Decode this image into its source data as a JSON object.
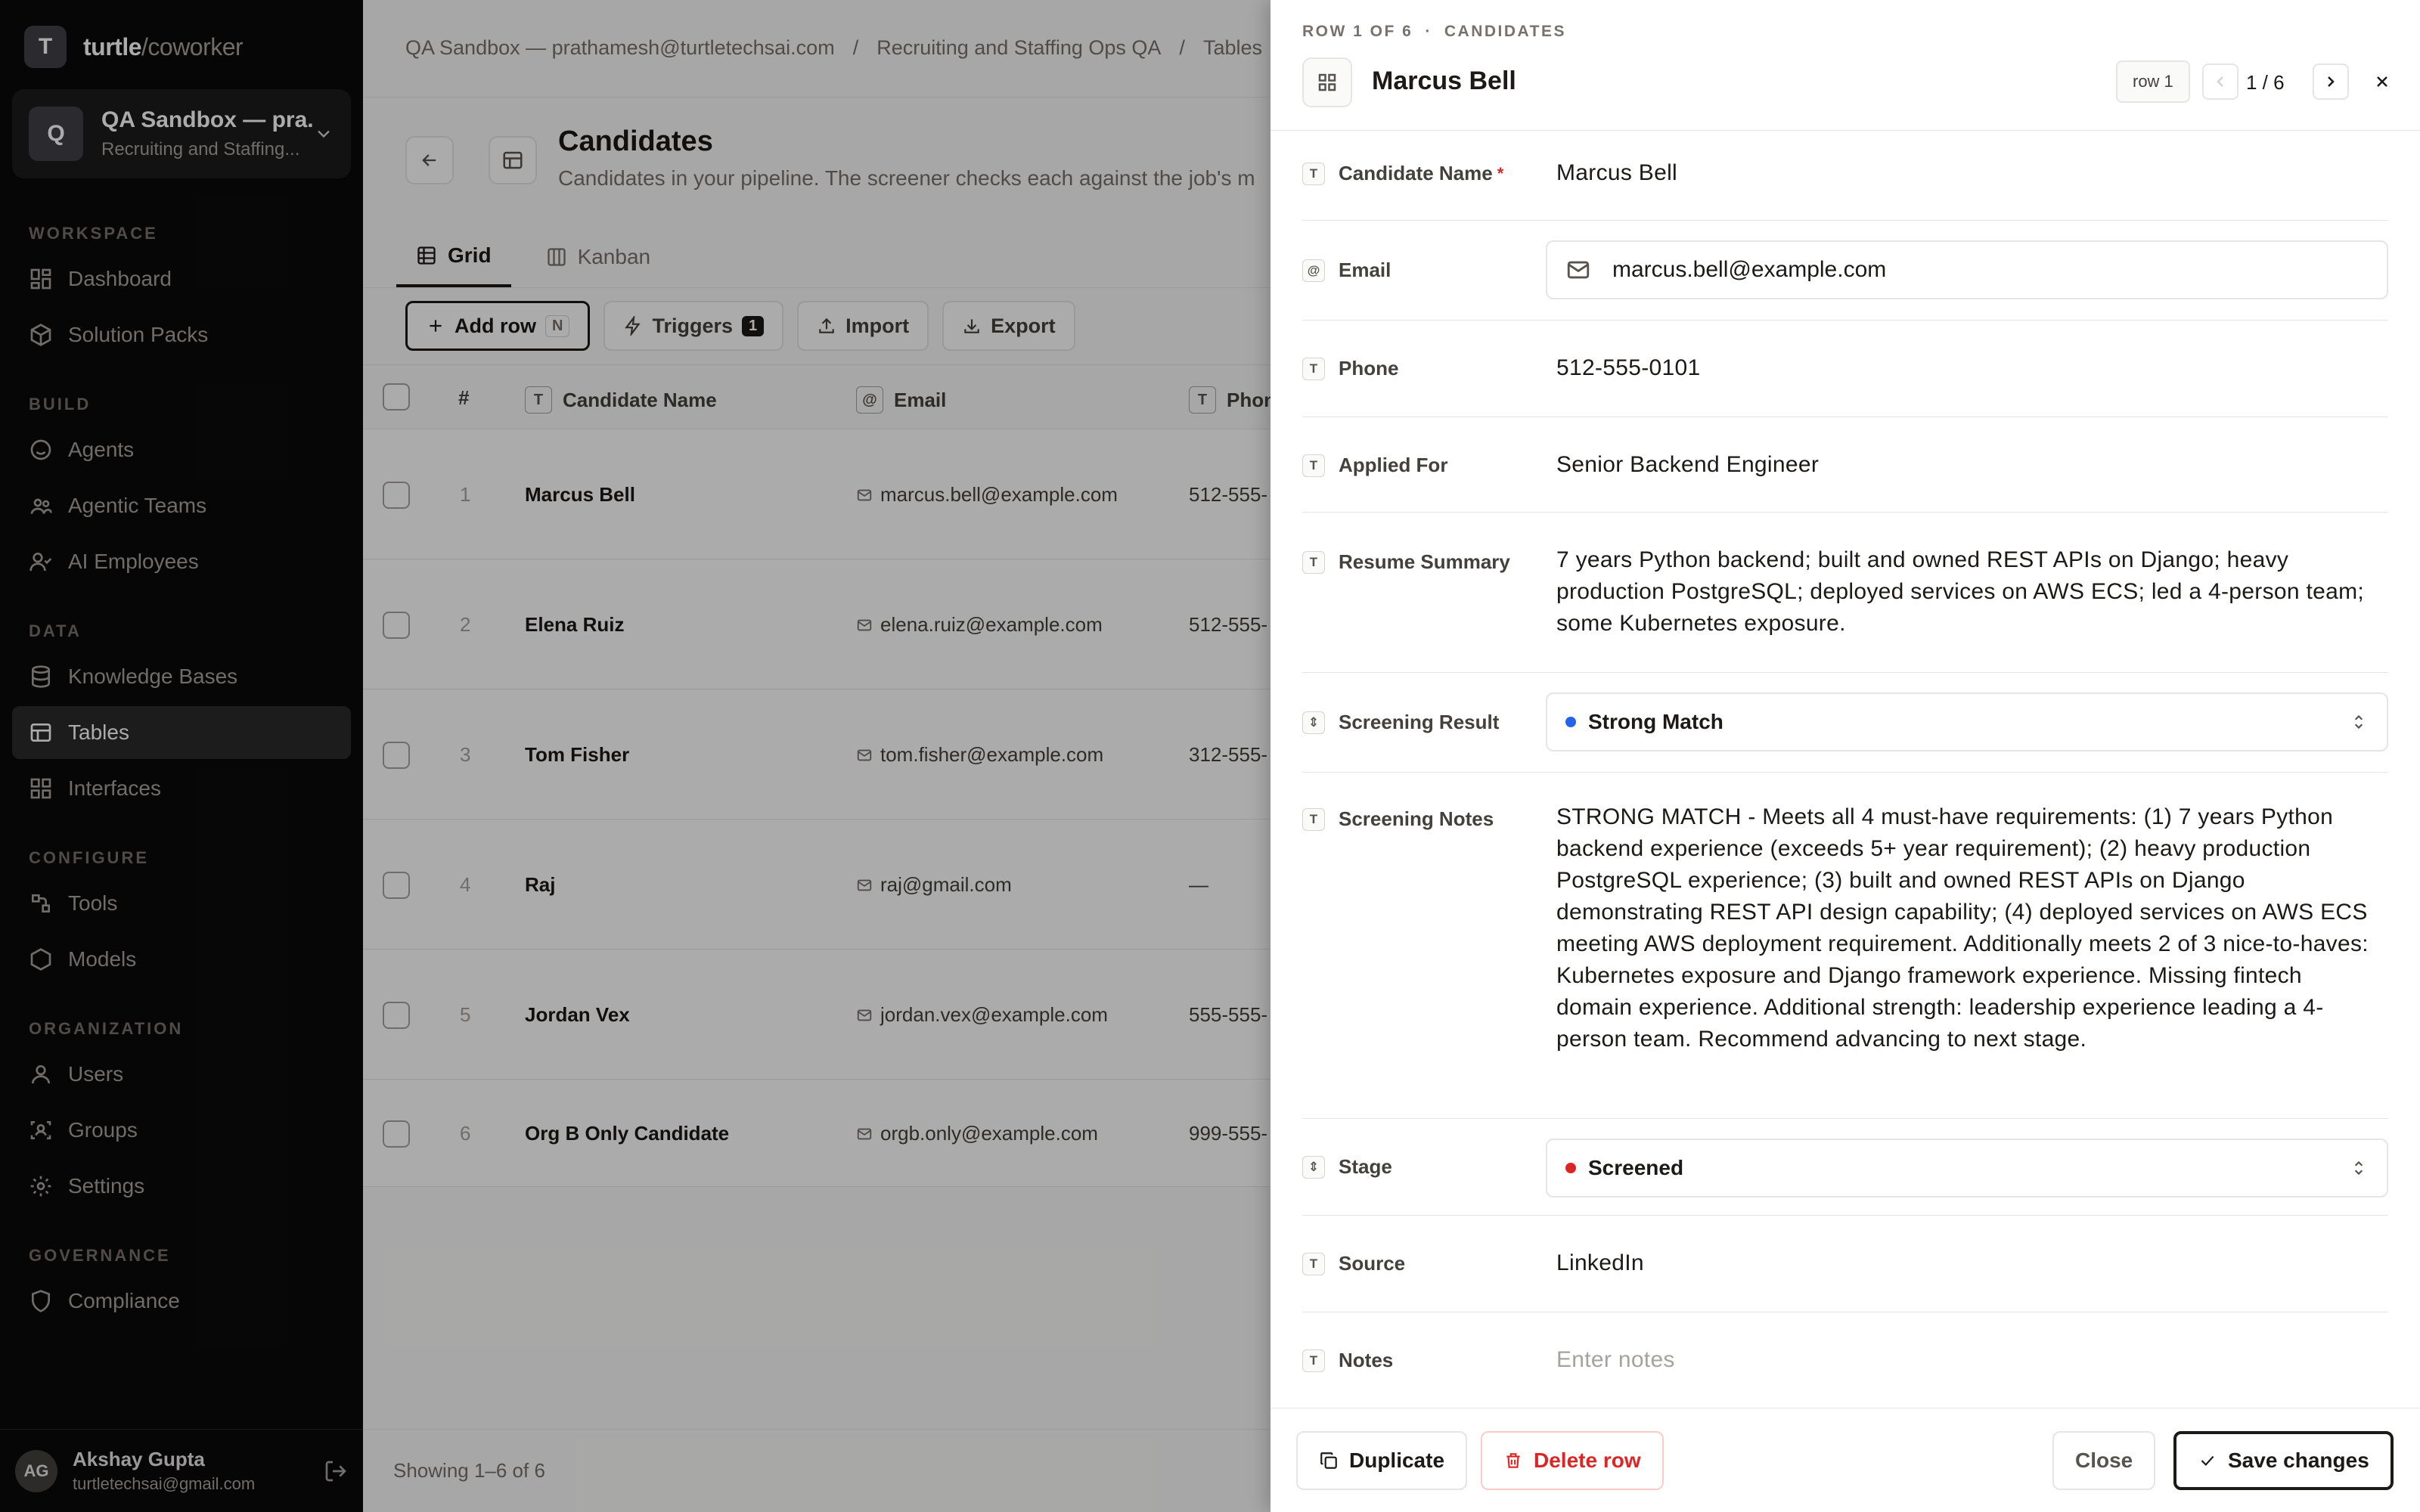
{
  "brand": {
    "logo_letter": "T",
    "name": "turtle",
    "suffix": "/coworker"
  },
  "workspace": {
    "avatar": "Q",
    "title": "QA Sandbox — pra...",
    "subtitle": "Recruiting and Staffing..."
  },
  "nav": {
    "sections": {
      "workspace": "WORKSPACE",
      "build": "BUILD",
      "data": "DATA",
      "configure": "CONFIGURE",
      "organization": "ORGANIZATION",
      "governance": "GOVERNANCE"
    },
    "items": {
      "dashboard": "Dashboard",
      "solution_packs": "Solution Packs",
      "agents": "Agents",
      "agentic_teams": "Agentic Teams",
      "ai_employees": "AI Employees",
      "knowledge_bases": "Knowledge Bases",
      "tables": "Tables",
      "interfaces": "Interfaces",
      "tools": "Tools",
      "models": "Models",
      "users": "Users",
      "groups": "Groups",
      "settings": "Settings",
      "compliance": "Compliance"
    },
    "active": "tables"
  },
  "user": {
    "initials": "AG",
    "name": "Akshay Gupta",
    "email": "turtletechsai@gmail.com"
  },
  "breadcrumb": {
    "workspace": "QA Sandbox — prathamesh@turtletechsai.com",
    "sep": "/",
    "project": "Recruiting and Staffing Ops QA",
    "section": "Tables"
  },
  "page": {
    "title": "Candidates",
    "description": "Candidates in your pipeline. The screener checks each against the job's m"
  },
  "tabs": {
    "grid": "Grid",
    "kanban": "Kanban"
  },
  "toolbar": {
    "add_row": "Add row",
    "add_row_key": "N",
    "triggers": "Triggers",
    "triggers_count": "1",
    "import": "Import",
    "export": "Export"
  },
  "grid": {
    "columns": {
      "num": "#",
      "name": "Candidate Name",
      "email": "Email",
      "phone": "Phon"
    },
    "col_types": {
      "name": "T",
      "email": "@",
      "phone": "T"
    },
    "rows": [
      {
        "num": "1",
        "name": "Marcus Bell",
        "email": "marcus.bell@example.com",
        "phone": "512-555-"
      },
      {
        "num": "2",
        "name": "Elena Ruiz",
        "email": "elena.ruiz@example.com",
        "phone": "512-555-"
      },
      {
        "num": "3",
        "name": "Tom Fisher",
        "email": "tom.fisher@example.com",
        "phone": "312-555-"
      },
      {
        "num": "4",
        "name": "Raj",
        "email": "raj@gmail.com",
        "phone": "—"
      },
      {
        "num": "5",
        "name": "Jordan Vex",
        "email": "jordan.vex@example.com",
        "phone": "555-555-"
      },
      {
        "num": "6",
        "name": "Org B Only Candidate",
        "email": "orgb.only@example.com",
        "phone": "999-555-"
      }
    ],
    "showing": "Showing 1–6 of 6"
  },
  "panel": {
    "row_label": "ROW 1 OF 6",
    "dot": "·",
    "table_label": "CANDIDATES",
    "title": "Marcus Bell",
    "row_chip": "row 1",
    "counter": "1 / 6",
    "fields": {
      "candidate_name": {
        "type": "T",
        "label": "Candidate Name",
        "required": "*",
        "value": "Marcus Bell"
      },
      "email": {
        "type": "@",
        "label": "Email",
        "value": "marcus.bell@example.com"
      },
      "phone": {
        "type": "T",
        "label": "Phone",
        "value": "512-555-0101"
      },
      "applied_for": {
        "type": "T",
        "label": "Applied For",
        "value": "Senior Backend Engineer"
      },
      "resume_summary": {
        "type": "T",
        "label": "Resume Summary",
        "value": "7 years Python backend; built and owned REST APIs on Django; heavy production PostgreSQL; deployed services on AWS ECS; led a 4-person team; some Kubernetes exposure."
      },
      "screening_result": {
        "type": "⇕",
        "label": "Screening Result",
        "value": "Strong Match",
        "dot_color": "#2563eb"
      },
      "screening_notes": {
        "type": "T",
        "label": "Screening Notes",
        "value": "STRONG MATCH - Meets all 4 must-have requirements: (1) 7 years Python backend experience (exceeds 5+ year requirement); (2) heavy production PostgreSQL experience; (3) built and owned REST APIs on Django demonstrating REST API design capability; (4) deployed services on AWS ECS meeting AWS deployment requirement. Additionally meets 2 of 3 nice-to-haves: Kubernetes exposure and Django framework experience. Missing fintech domain experience. Additional strength: leadership experience leading a 4-person team. Recommend advancing to next stage."
      },
      "stage": {
        "type": "⇕",
        "label": "Stage",
        "value": "Screened",
        "dot_color": "#dc2626"
      },
      "source": {
        "type": "T",
        "label": "Source",
        "value": "LinkedIn"
      },
      "notes": {
        "type": "T",
        "label": "Notes",
        "placeholder": "Enter notes"
      }
    },
    "footer": {
      "duplicate": "Duplicate",
      "delete": "Delete row",
      "close": "Close",
      "save": "Save changes"
    }
  }
}
